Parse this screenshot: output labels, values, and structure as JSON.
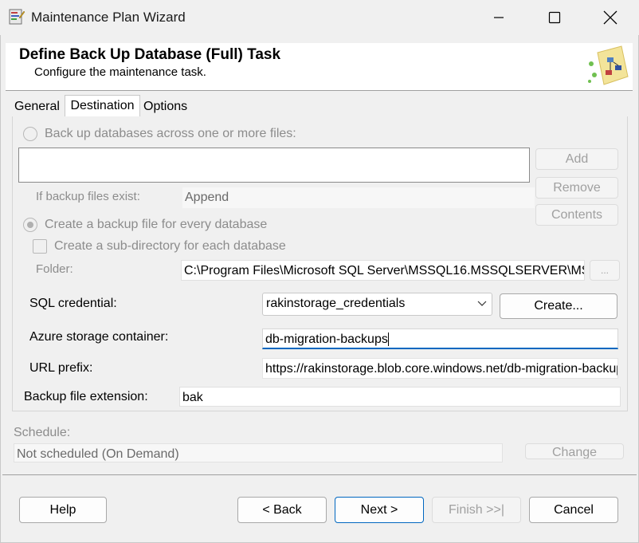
{
  "window": {
    "title": "Maintenance Plan Wizard",
    "icons": {
      "app": "wizard-app-icon",
      "minimize": "minimize-icon",
      "maximize": "maximize-icon",
      "close": "close-icon"
    }
  },
  "header": {
    "title": "Define Back Up Database (Full) Task",
    "subtitle": "Configure the maintenance task."
  },
  "tabs": [
    {
      "label": "General"
    },
    {
      "label": "Destination",
      "selected": true
    },
    {
      "label": "Options"
    }
  ],
  "destination": {
    "across_files_label": "Back up databases across one or more files:",
    "add_label": "Add",
    "remove_label": "Remove",
    "contents_label": "Contents",
    "if_exist_label": "If backup files exist:",
    "if_exist_value": "Append",
    "every_db_label": "Create a backup file for every database",
    "subdir_label": "Create a sub-directory for each database",
    "folder_label": "Folder:",
    "folder_value": "C:\\Program Files\\Microsoft SQL Server\\MSSQL16.MSSQLSERVER\\MS",
    "browse_label": "...",
    "sql_credential_label": "SQL credential:",
    "sql_credential_value": "rakinstorage_credentials",
    "create_label": "Create...",
    "azure_container_label": "Azure storage container:",
    "azure_container_value": "db-migration-backups",
    "url_prefix_label": "URL prefix:",
    "url_prefix_value": "https://rakinstorage.blob.core.windows.net/db-migration-backup",
    "ext_label": "Backup file extension:",
    "ext_value": "bak"
  },
  "schedule": {
    "label": "Schedule:",
    "value": "Not scheduled (On Demand)",
    "change_label": "Change"
  },
  "footer": {
    "help": "Help",
    "back": "< Back",
    "next": "Next >",
    "finish": "Finish >>|",
    "cancel": "Cancel"
  },
  "colors": {
    "accent": "#0067c0",
    "disabled_text": "#8c8c8c"
  }
}
